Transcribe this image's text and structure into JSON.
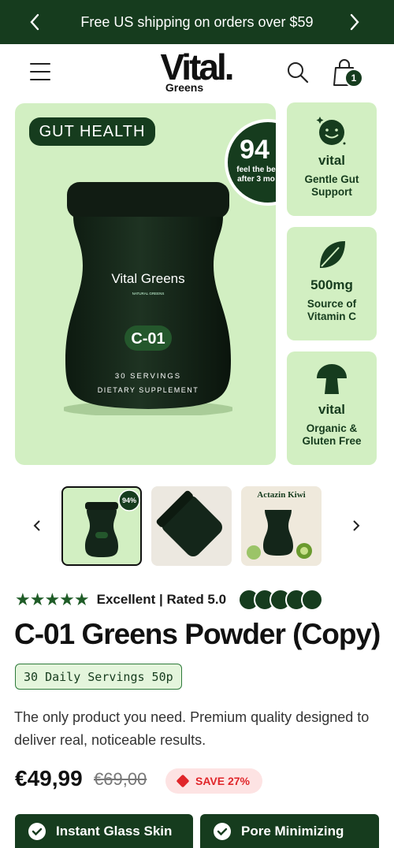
{
  "announcement": {
    "text": "Free US shipping on orders over $59"
  },
  "header": {
    "logo_main": "Vital.",
    "logo_sub": "Greens",
    "cart_count": "1"
  },
  "hero": {
    "badge": "GUT HEALTH",
    "percent_badge": {
      "number": "94",
      "text_line1": "feel the be",
      "text_line2": "after 3 mo"
    },
    "jar": {
      "brand": "Vital Greens",
      "subbrand": "NATURAL GREENS",
      "code": "C-01",
      "line1": "30 SERVINGS",
      "line2": "DIETARY SUPPLEMENT"
    }
  },
  "features": [
    {
      "icon": "smiley-icon",
      "heading": "vital",
      "sub": "Gentle Gut Support"
    },
    {
      "icon": "leaf-icon",
      "heading": "500mg",
      "sub": "Source of Vitamin C"
    },
    {
      "icon": "mushroom-icon",
      "heading": "vital",
      "sub": "Organic & Gluten Free"
    }
  ],
  "thumbnails": [
    {
      "label": "94%"
    },
    {
      "label": ""
    },
    {
      "label": "Actazin Kiwi"
    }
  ],
  "rating": {
    "stars": "★★★★★",
    "text": "Excellent | Rated 5.0"
  },
  "product": {
    "title": "C-01 Greens Powder (Copy)",
    "servings": "30 Daily Servings 50p",
    "description": "The only product you need. Premium quality designed to deliver real, noticeable results.",
    "price": "€49,99",
    "compare_price": "€69,00",
    "save_label": "SAVE 27%"
  },
  "benefits": [
    "Instant Glass Skin",
    "Pore Minimizing"
  ],
  "colors": {
    "brand": "#163c1e",
    "mint": "#d2efc2",
    "sale": "#e0262a"
  }
}
